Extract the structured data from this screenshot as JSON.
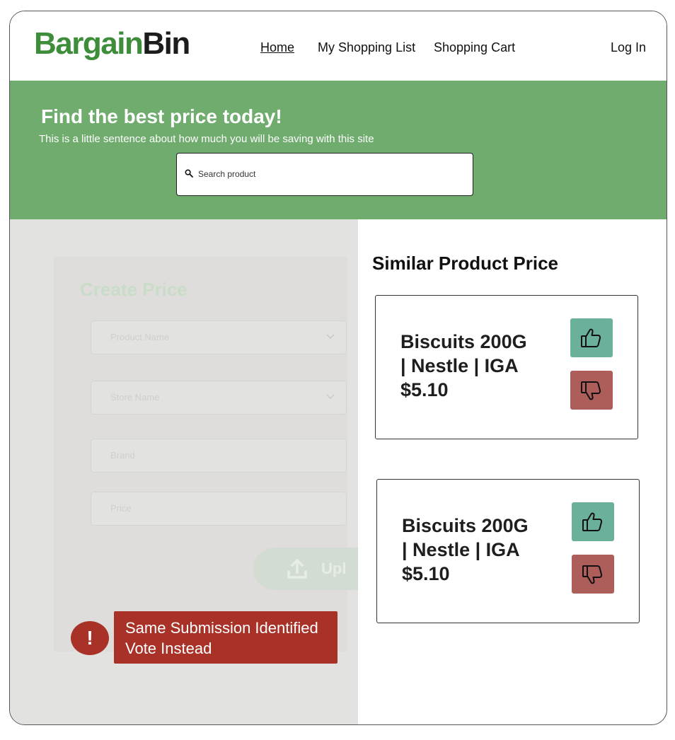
{
  "header": {
    "logo_part1": "Bargain",
    "logo_part2": "Bin",
    "nav": {
      "home": "Home",
      "shopping_list": "My Shopping List",
      "shopping_cart": "Shopping Cart",
      "login": "Log In"
    }
  },
  "hero": {
    "title": "Find the best price today!",
    "subtitle": "This is a little sentence about how much you will be saving with this site",
    "search_placeholder": "Search product"
  },
  "create_form": {
    "title": "Create Price",
    "fields": [
      "Product Name",
      "Store Name",
      "Brand",
      "Price"
    ],
    "upload_label": "Upl"
  },
  "error": {
    "icon_text": "!",
    "line1": "Same Submission Identified",
    "line2": "Vote Instead"
  },
  "similar": {
    "title": "Similar Product Price",
    "cards": [
      {
        "line1": "Biscuits 200G",
        "line2": "| Nestle | IGA",
        "price": "$5.10"
      },
      {
        "line1": "Biscuits 200G",
        "line2": "| Nestle | IGA",
        "price": "$5.10"
      }
    ]
  },
  "colors": {
    "brand_green": "#3e8d3a",
    "hero_green": "#6fac6e",
    "upvote": "#6bb09b",
    "downvote": "#ad5e5a",
    "error_red": "#a93228"
  },
  "icons": [
    "search-icon",
    "chevron-down-icon",
    "upload-icon",
    "exclamation-icon",
    "thumbs-up-icon",
    "thumbs-down-icon"
  ]
}
